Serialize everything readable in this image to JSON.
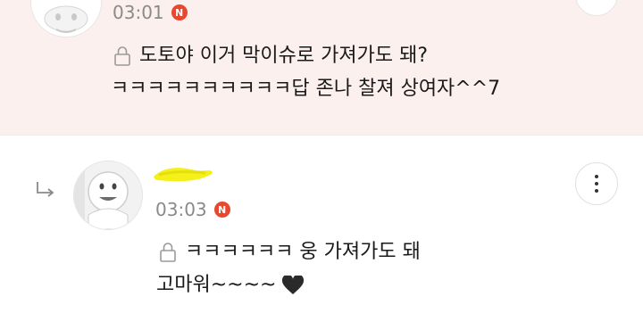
{
  "top_comment": {
    "time": "03:01",
    "badge": "N",
    "line1": "도토야 이거 막이슈로 가져가도 돼?",
    "line2": "ㅋㅋㅋㅋㅋㅋㅋㅋㅋㅋ답 존나 찰져 상여자^^7"
  },
  "reply": {
    "time": "03:03",
    "badge": "N",
    "line1": "ㅋㅋㅋㅋㅋㅋ 웅 가져가도 돼",
    "line2": "고마워~~~~"
  },
  "colors": {
    "top_bg": "#fbf0ee",
    "badge": "#e8482f",
    "nickname_highlight": "#f5ef1a"
  }
}
